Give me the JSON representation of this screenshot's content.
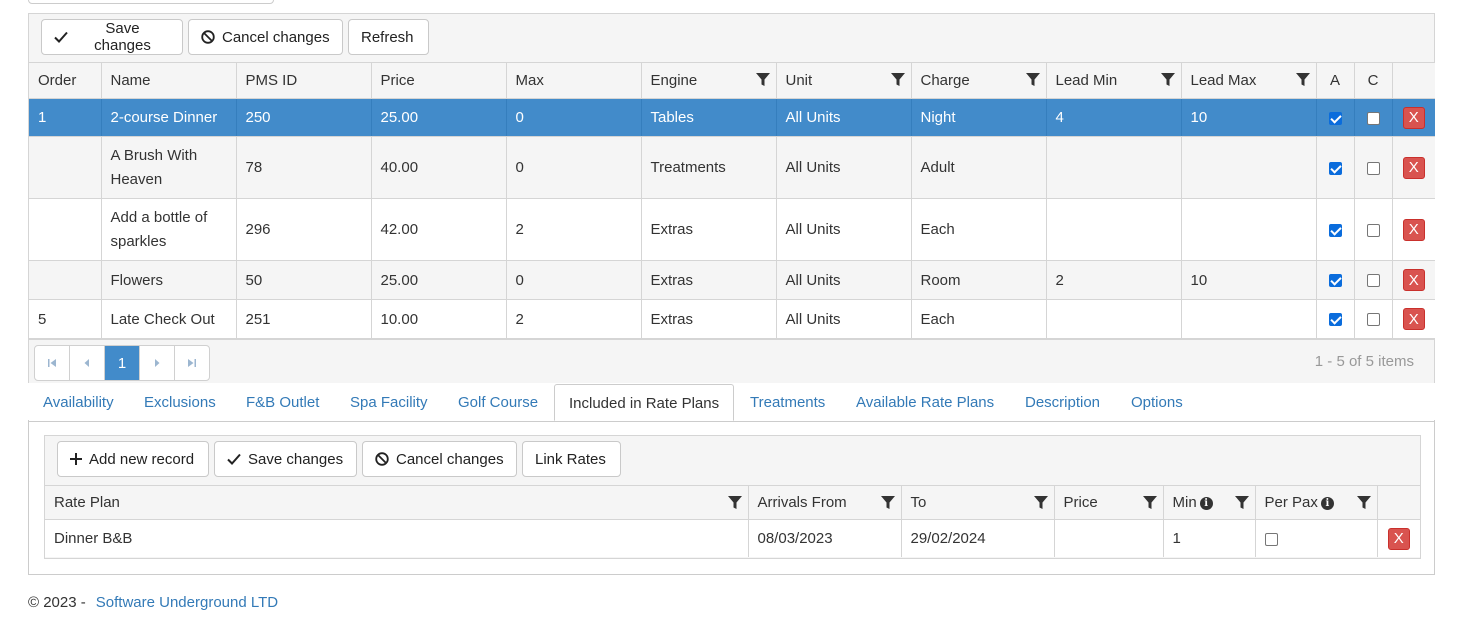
{
  "grid": {
    "toolbar": {
      "save": "Save changes",
      "cancel": "Cancel changes",
      "refresh": "Refresh"
    },
    "columns": [
      "Order",
      "Name",
      "PMS ID",
      "Price",
      "Max",
      "Engine",
      "Unit",
      "Charge",
      "Lead Min",
      "Lead Max",
      "A",
      "C"
    ],
    "rows": [
      {
        "order": "1",
        "name": "2-course Dinner",
        "pms": "250",
        "price": "25.00",
        "max": "0",
        "engine": "Tables",
        "unit": "All Units",
        "charge": "Night",
        "leadmin": "4",
        "leadmax": "10",
        "a": true,
        "c": false,
        "selected": true
      },
      {
        "order": "",
        "name": "A Brush With Heaven",
        "pms": "78",
        "price": "40.00",
        "max": "0",
        "engine": "Treatments",
        "unit": "All Units",
        "charge": "Adult",
        "leadmin": "",
        "leadmax": "",
        "a": true,
        "c": false
      },
      {
        "order": "",
        "name": "Add a bottle of sparkles",
        "pms": "296",
        "price": "42.00",
        "max": "2",
        "engine": "Extras",
        "unit": "All Units",
        "charge": "Each",
        "leadmin": "",
        "leadmax": "",
        "a": true,
        "c": false
      },
      {
        "order": "",
        "name": "Flowers",
        "pms": "50",
        "price": "25.00",
        "max": "0",
        "engine": "Extras",
        "unit": "All Units",
        "charge": "Room",
        "leadmin": "2",
        "leadmax": "10",
        "a": true,
        "c": false
      },
      {
        "order": "5",
        "name": "Late Check Out",
        "pms": "251",
        "price": "10.00",
        "max": "2",
        "engine": "Extras",
        "unit": "All Units",
        "charge": "Each",
        "leadmin": "",
        "leadmax": "",
        "a": true,
        "c": false
      }
    ],
    "delete_label": "X",
    "pager": {
      "current": "1",
      "info": "1 - 5 of 5 items"
    }
  },
  "tabs": [
    "Availability",
    "Exclusions",
    "F&B Outlet",
    "Spa Facility",
    "Golf Course",
    "Included in Rate Plans",
    "Treatments",
    "Available Rate Plans",
    "Description",
    "Options"
  ],
  "active_tab": "Included in Rate Plans",
  "rate_grid": {
    "toolbar": {
      "add": "Add new record",
      "save": "Save changes",
      "cancel": "Cancel changes",
      "link": "Link Rates"
    },
    "columns": [
      "Rate Plan",
      "Arrivals From",
      "To",
      "Price",
      "Min",
      "Per Pax"
    ],
    "rows": [
      {
        "rate_plan": "Dinner B&B",
        "arrivals_from": "08/03/2023",
        "to": "29/02/2024",
        "price": "",
        "min": "1",
        "per_pax": false
      }
    ],
    "delete_label": "X"
  },
  "footer": {
    "copyright": "© 2023 -",
    "company": "Software Underground LTD"
  },
  "colors": {
    "selected_row": "#428bca",
    "delete": "#d9534f",
    "link": "#337ab7"
  }
}
